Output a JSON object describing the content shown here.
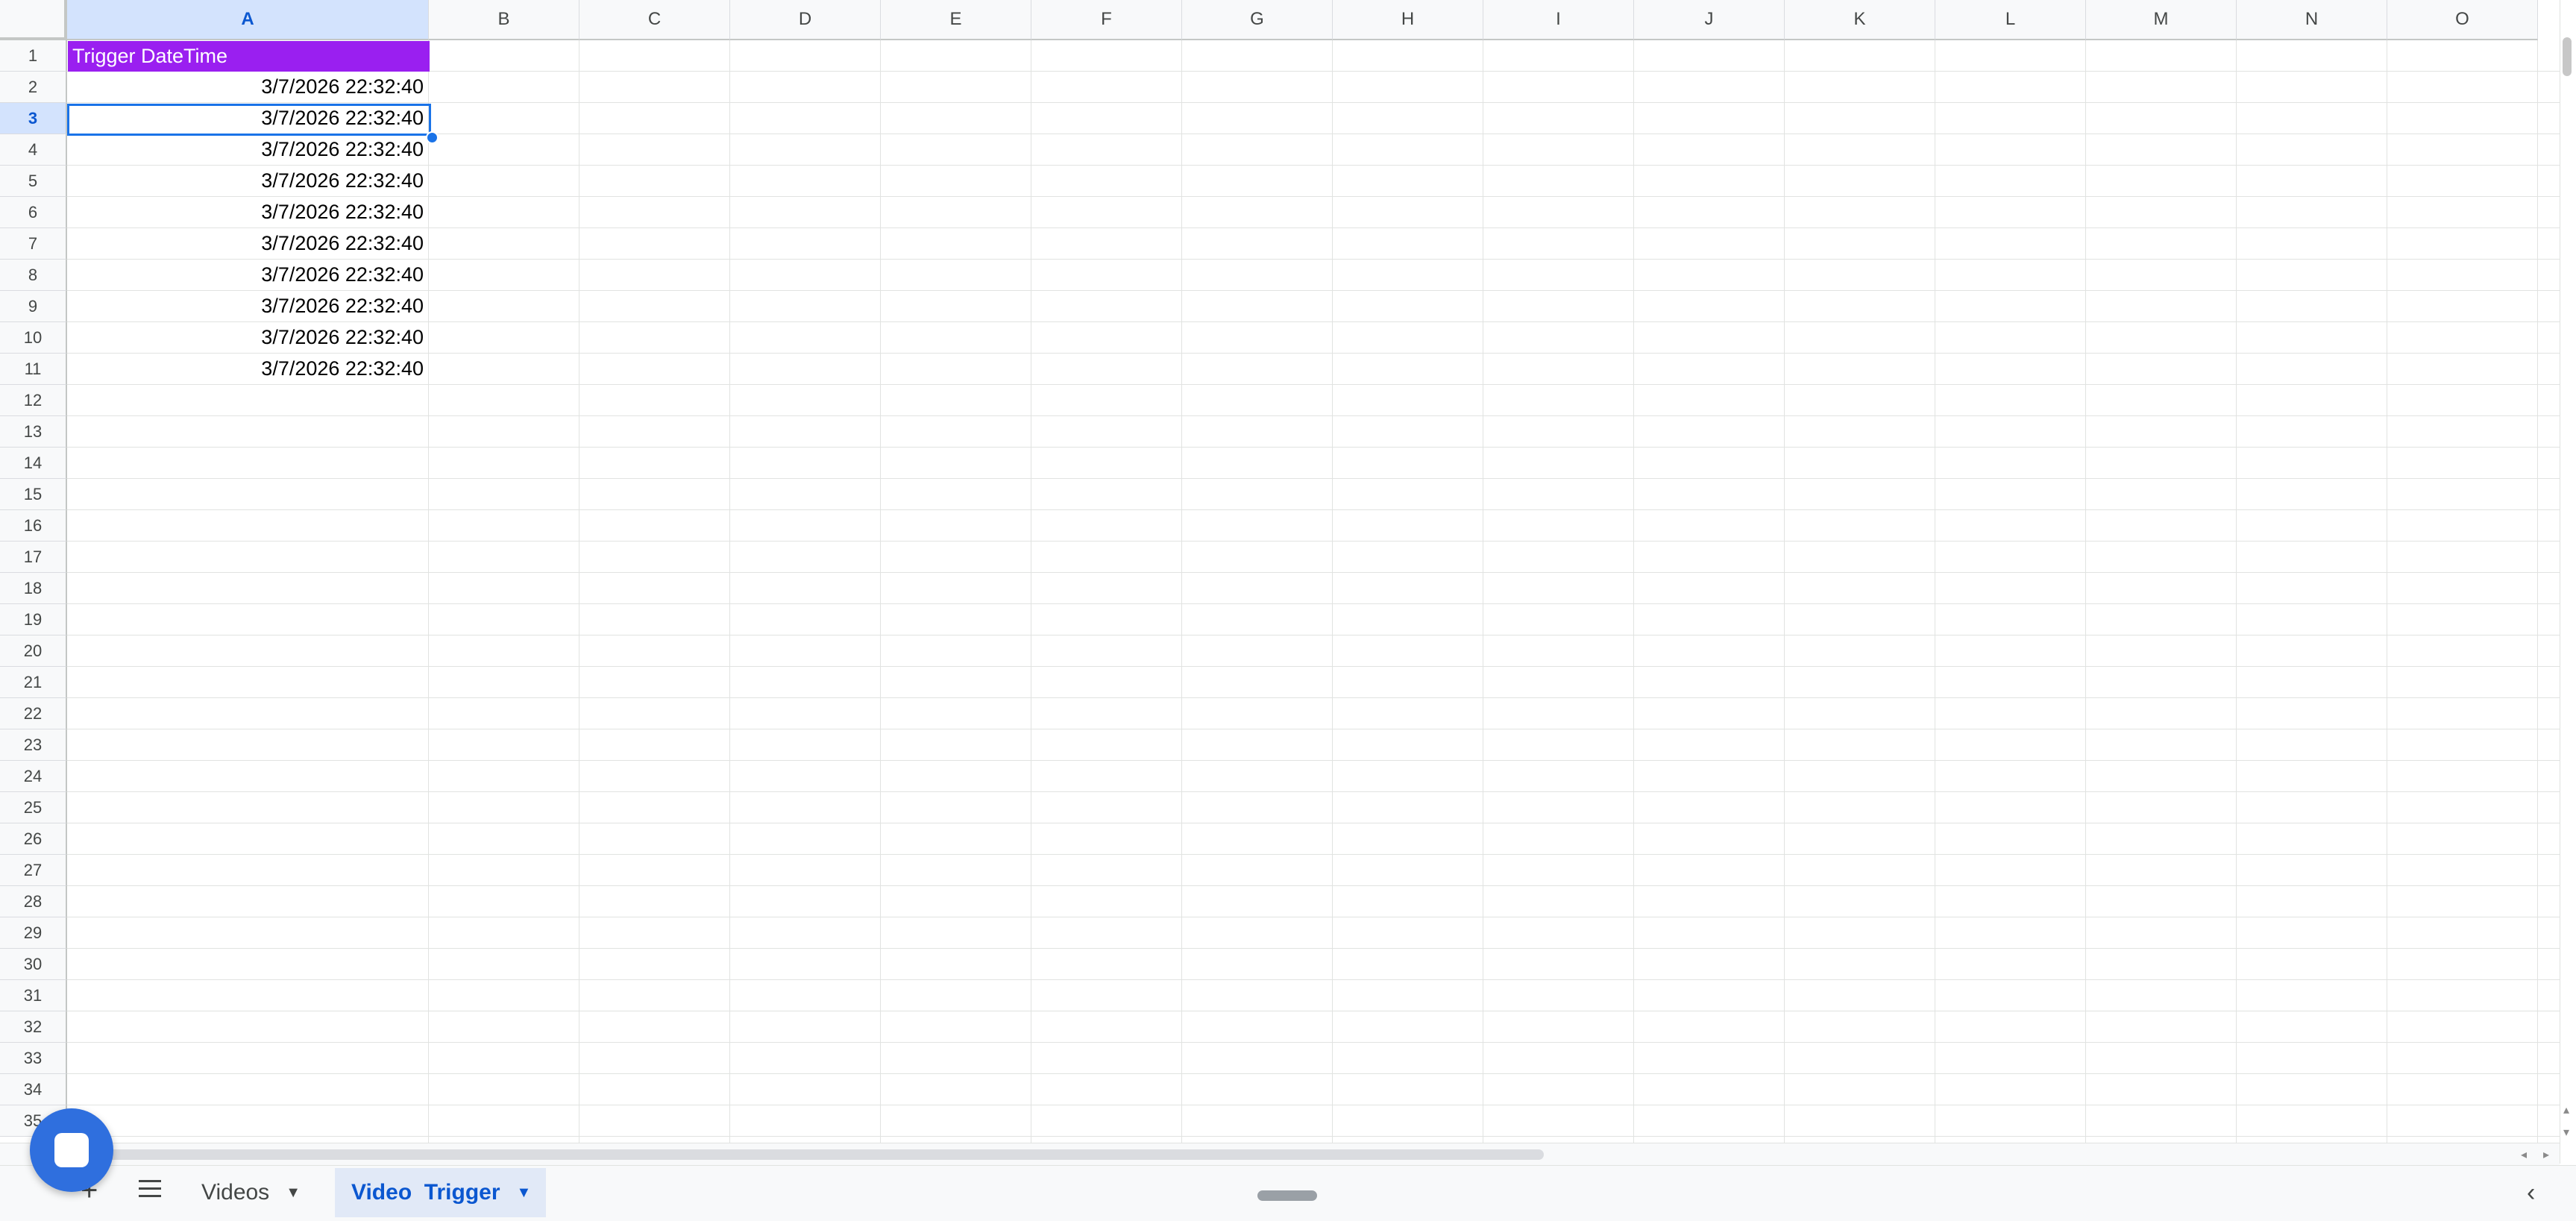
{
  "columns": [
    "A",
    "B",
    "C",
    "D",
    "E",
    "F",
    "G",
    "H",
    "I",
    "J",
    "K",
    "L",
    "M",
    "N",
    "O"
  ],
  "rows": [
    "1",
    "2",
    "3",
    "4",
    "5",
    "6",
    "7",
    "8",
    "9",
    "10",
    "11",
    "12",
    "13",
    "14",
    "15",
    "16",
    "17",
    "18",
    "19",
    "20",
    "21",
    "22",
    "23",
    "24",
    "25",
    "26",
    "27",
    "28",
    "29",
    "30",
    "31",
    "32",
    "33",
    "34",
    "35"
  ],
  "selected_column": "A",
  "selected_row": "3",
  "header": {
    "text": "Trigger DateTime",
    "background": "#9a1ff0",
    "color": "#ffffff"
  },
  "data": [
    "3/7/2026 22:32:40",
    "3/7/2026 22:32:40",
    "3/7/2026 22:32:40",
    "3/7/2026 22:32:40",
    "3/7/2026 22:32:40",
    "3/7/2026 22:32:40",
    "3/7/2026 22:32:40",
    "3/7/2026 22:32:40",
    "3/7/2026 22:32:40",
    "3/7/2026 22:32:40"
  ],
  "tabs": [
    {
      "label": "Videos"
    },
    {
      "label": "Video  Trigger",
      "active": true
    }
  ],
  "icons": {
    "add_sheet": "plus-icon",
    "all_sheets": "menu-icon",
    "chevron": "chevron-left-icon",
    "fab": "stop-icon"
  },
  "colors": {
    "accent": "#1a73e8",
    "active_tab": "#0b57d0"
  }
}
